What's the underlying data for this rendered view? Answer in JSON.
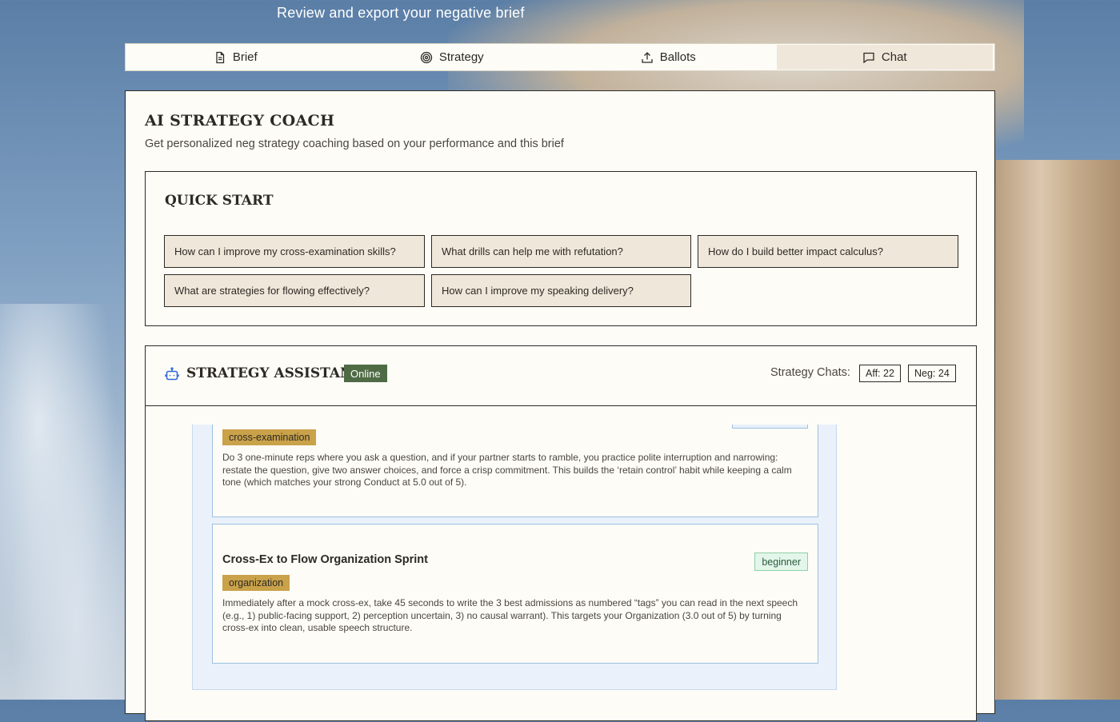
{
  "header": {
    "subtitle": "Review and export your negative brief"
  },
  "tabs": [
    {
      "label": "Brief",
      "icon": "document-icon",
      "active": false
    },
    {
      "label": "Strategy",
      "icon": "target-icon",
      "active": false
    },
    {
      "label": "Ballots",
      "icon": "upload-icon",
      "active": false
    },
    {
      "label": "Chat",
      "icon": "chat-icon",
      "active": true
    }
  ],
  "coach": {
    "title": "AI STRATEGY COACH",
    "subtitle": "Get personalized neg strategy coaching based on your performance and this brief"
  },
  "quick_start": {
    "title": "QUICK START",
    "questions": [
      "How can I improve my cross-examination skills?",
      "What drills can help me with refutation?",
      "How do I build better impact calculus?",
      "What are strategies for flowing effectively?",
      "How can I improve my speaking delivery?"
    ]
  },
  "assistant": {
    "title": "STRATEGY ASSISTANT",
    "status": "Online",
    "chats_label": "Strategy Chats:",
    "aff_count": "Aff: 22",
    "neg_count": "Neg: 24"
  },
  "drills": [
    {
      "title": "",
      "tag": "cross-examination",
      "level": "",
      "text": "Do 3 one-minute reps where you ask a question, and if your partner starts to ramble, you practice polite interruption and narrowing: restate the question, give two answer choices, and force a crisp commitment. This builds the ‘retain control’ habit while keeping a calm tone (which matches your strong Conduct at 5.0 out of 5)."
    },
    {
      "title": "Cross-Ex to Flow Organization Sprint",
      "tag": "organization",
      "level": "beginner",
      "text": "Immediately after a mock cross-ex, take 45 seconds to write the 3 best admissions as numbered “tags” you can read in the next speech (e.g., 1) public-facing support, 2) perception uncertain, 3) no causal warrant). This targets your Organization (3.0 out of 5) by turning cross-ex into clean, usable speech structure."
    }
  ],
  "colors": {
    "accent_tab": "#efe7da",
    "online": "#4f6b45",
    "tag": "#c9a24a",
    "beginner_badge": "#e3f6ea"
  }
}
